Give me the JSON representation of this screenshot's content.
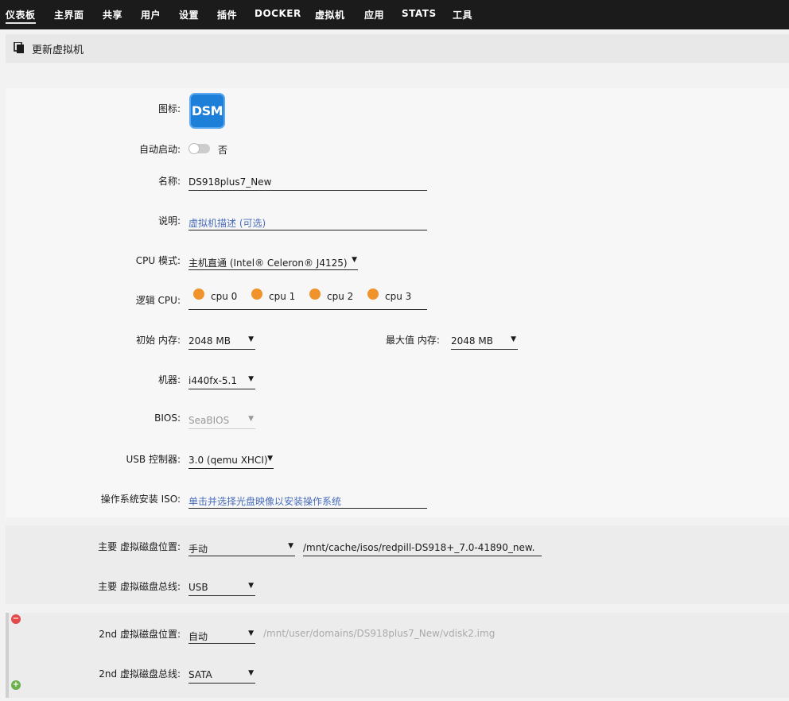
{
  "nav": {
    "items": [
      "仪表板",
      "主界面",
      "共享",
      "用户",
      "设置",
      "插件",
      "DOCKER",
      "虚拟机",
      "应用",
      "STATS",
      "工具"
    ],
    "active": "仪表板"
  },
  "page": {
    "title": "更新虚拟机"
  },
  "form": {
    "icon_label": "图标:",
    "icon_text": "DSM",
    "autostart_label": "自动启动:",
    "autostart_value": "否",
    "name_label": "名称:",
    "name_value": "DS918plus7_New",
    "desc_label": "说明:",
    "desc_placeholder": "虚拟机描述 (可选)",
    "cpu_mode_label": "CPU 模式:",
    "cpu_mode_value": "主机直通 (Intel® Celeron® J4125)",
    "logical_cpu_label": "逻辑 CPU:",
    "cpus": [
      "cpu 0",
      "cpu 1",
      "cpu 2",
      "cpu 3"
    ],
    "init_mem_label": "初始 内存:",
    "init_mem_value": "2048 MB",
    "max_mem_label": "最大值 内存:",
    "max_mem_value": "2048 MB",
    "machine_label": "机器:",
    "machine_value": "i440fx-5.1",
    "bios_label": "BIOS:",
    "bios_value": "SeaBIOS",
    "usb_label": "USB 控制器:",
    "usb_value": "3.0 (qemu XHCI)",
    "iso_label": "操作系统安装 ISO:",
    "iso_placeholder": "单击并选择光盘映像以安装操作系统"
  },
  "disk1": {
    "location_label": "主要 虚拟磁盘位置:",
    "location_value": "手动",
    "path_value": "/mnt/cache/isos/redpill-DS918+_7.0-41890_new.",
    "bus_label": "主要 虚拟磁盘总线:",
    "bus_value": "USB"
  },
  "disk2": {
    "location_label": "2nd 虚拟磁盘位置:",
    "location_value": "自动",
    "path_value": "/mnt/user/domains/DS918plus7_New/vdisk2.img",
    "bus_label": "2nd 虚拟磁盘总线:",
    "bus_value": "SATA"
  },
  "colors": {
    "nav_bg": "#1c1b1b",
    "cpu_dot": "#f0932b",
    "link": "#486dba",
    "remove": "#e24a4a",
    "add": "#6ab04c"
  }
}
